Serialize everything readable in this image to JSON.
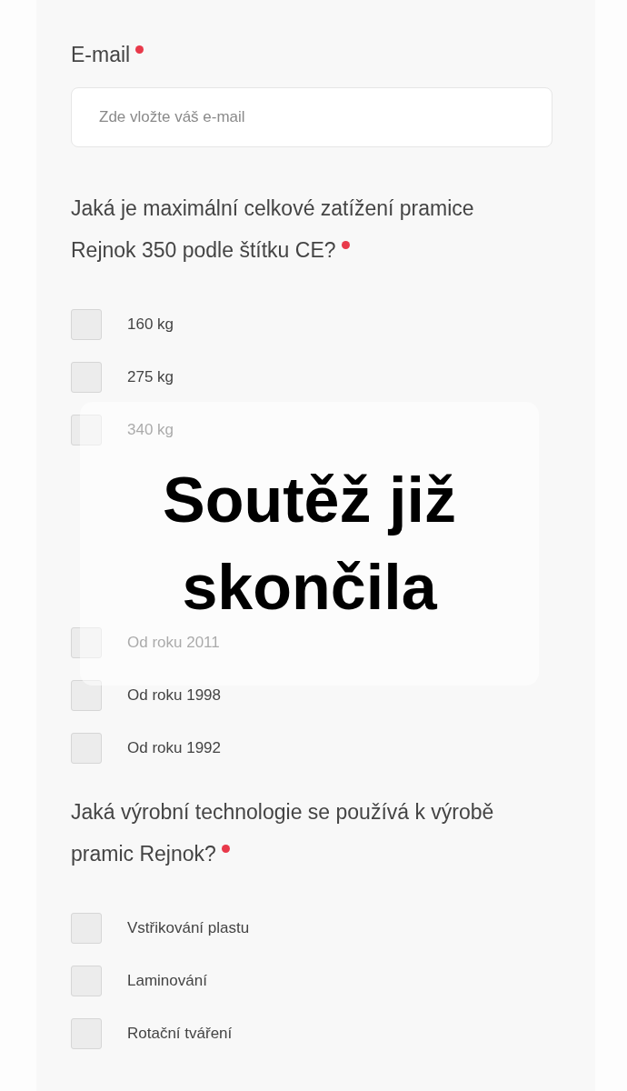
{
  "form": {
    "email": {
      "label": "E-mail",
      "required": true,
      "placeholder": "Zde vložte váš e-mail"
    },
    "questions": [
      {
        "text": "Jaká je maximální celkové zatížení pramice Rejnok 350 podle štítku CE?",
        "required": true,
        "options": [
          {
            "label": "160 kg",
            "checked": false
          },
          {
            "label": "275 kg",
            "checked": false
          },
          {
            "label": "340 kg",
            "checked": false
          }
        ]
      },
      {
        "options": [
          {
            "label": "Od roku 2011",
            "checked": false
          },
          {
            "label": "Od roku 1998",
            "checked": false
          },
          {
            "label": "Od roku 1992",
            "checked": false
          }
        ]
      },
      {
        "text": "Jaká výrobní technologie se používá k výrobě pramic Rejnok?",
        "required": true,
        "options": [
          {
            "label": "Vstřikování plastu",
            "checked": false
          },
          {
            "label": "Laminování",
            "checked": false
          },
          {
            "label": "Rotační tváření",
            "checked": false
          }
        ]
      }
    ]
  },
  "overlay": {
    "message": "Soutěž již skončila"
  }
}
